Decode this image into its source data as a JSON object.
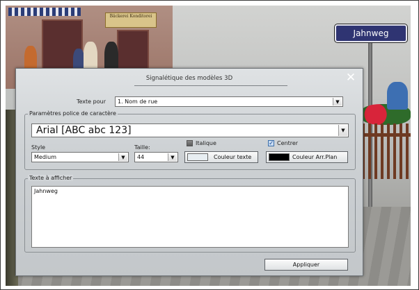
{
  "scene": {
    "street_sign": "Jahnweg",
    "shop_sign": "Bäckerei Konditorei"
  },
  "dialog": {
    "title": "Signalétique des modèles 3D",
    "close_icon": "close-icon",
    "texte_pour": {
      "label": "Texte pour",
      "value": "1. Nom de rue"
    },
    "police": {
      "group_label": "Paramètres police de caractère",
      "font_value": "Arial  [ABC abc 123]",
      "style_label": "Style",
      "style_value": "Medium",
      "taille_label": "Taille:",
      "taille_value": "44",
      "italique_label": "Italique",
      "italique_checked": false,
      "centrer_label": "Centrer",
      "centrer_checked": true,
      "couleur_texte_label": "Couleur texte",
      "couleur_texte_color": "#e8eef2",
      "couleur_fond_label": "Couleur Arr.Plan",
      "couleur_fond_color": "#000000"
    },
    "texte": {
      "group_label": "Texte à afficher",
      "value": "Jahnweg"
    },
    "apply_label": "Appliquer"
  },
  "colors": {
    "street_sign_bg": "#2f3472",
    "dialog_bg": "#cdd1d4"
  }
}
